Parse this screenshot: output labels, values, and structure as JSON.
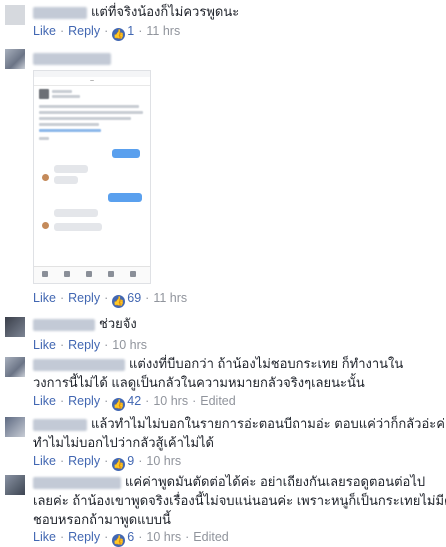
{
  "reply_label": "Reply",
  "comments": [
    {
      "lines": [
        "แต่ที่จริงน้องก็ไม่ควรพูดนะ"
      ],
      "likes": "1",
      "time": "11 hrs",
      "edited": ""
    },
    {
      "lines": [],
      "likes": "69",
      "time": "11 hrs",
      "edited": ""
    },
    {
      "lines": [
        "ช่วยจัง"
      ],
      "likes": "",
      "time": "10 hrs",
      "edited": ""
    },
    {
      "lines": [
        "แต่งงที่บีบอกว่า ถ้าน้องไม่ชอบกระเทย ก็ทำงานใน",
        "วงการนี้ไม่ได้ แลดูเป็นกลัวในความหมายกลัวจริงๆเลยนะนั้น"
      ],
      "likes": "42",
      "time": "10 hrs",
      "edited": "Edited"
    },
    {
      "lines": [
        "แล้วทำไมไม่บอกในรายการอ่ะตอนบีถามอ่ะ ตอบแค่ว่าก็กลัวอ่ะค่ะ",
        "ทำไมไม่บอกไปว่ากลัวสู้เค้าไม่ได้"
      ],
      "likes": "9",
      "time": "10 hrs",
      "edited": ""
    },
    {
      "lines": [
        "แค่ค่าพูดมันตัดต่อได้ค่ะ อย่าเถียงกันเลยรอดูตอนต่อไป",
        "เลยค่ะ ถ้าน้องเขาพูดจริงเรื่องนี้ไม่จบแน่นอนค่ะ เพราะหนูก็เป็นกระเทยไม่มีคย",
        "ชอบหรอกถ้ามาพูดแบบนี้"
      ],
      "likes": "6",
      "time": "10 hrs",
      "edited": "Edited"
    }
  ],
  "like_label": "Like",
  "colors": {
    "link": "#4267b2",
    "meta": "#90949c",
    "text": "#1d2129"
  }
}
